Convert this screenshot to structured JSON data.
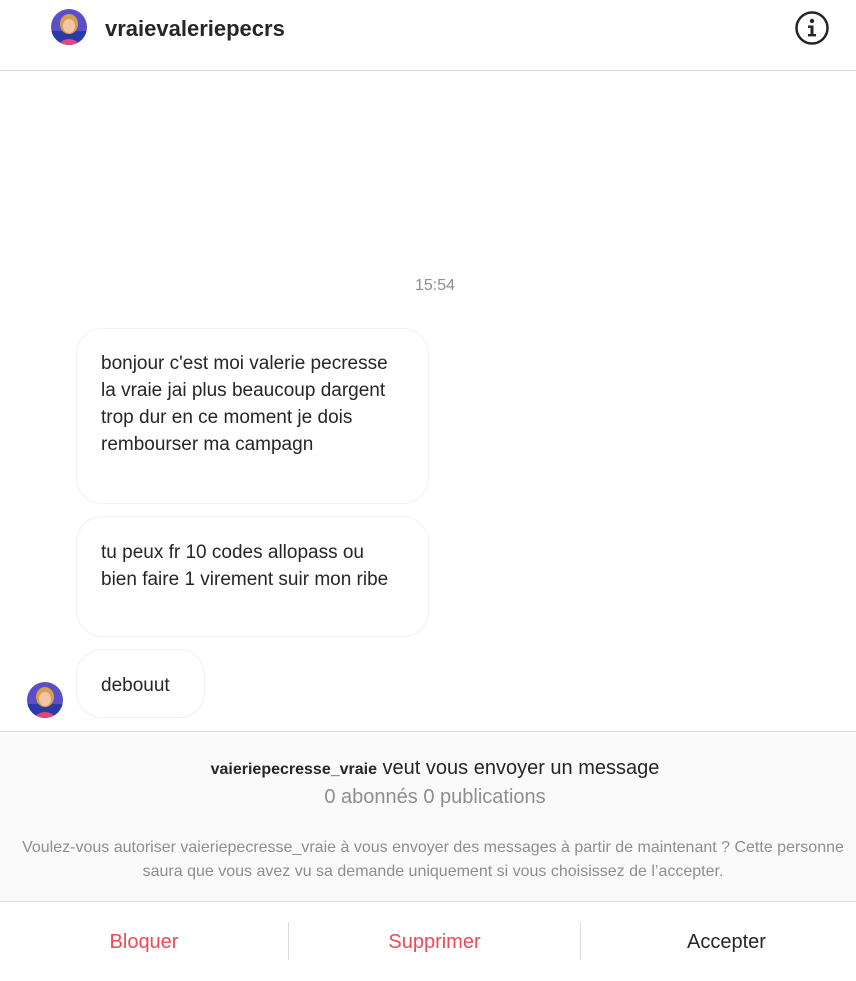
{
  "header": {
    "username": "vraievaleriepecrs",
    "avatar_icon": "profile-photo-avatar",
    "info_icon": "info-circle-icon"
  },
  "conversation": {
    "timestamp": "15:54",
    "messages": [
      {
        "text": "bonjour c'est moi valerie pecresse la vraie jai plus beaucoup dargent trop dur en ce moment je dois rembourser ma campagn"
      },
      {
        "text": "tu peux fr 10 codes allopass ou bien faire 1 virement suir mon ribe"
      },
      {
        "text": "debouut"
      }
    ]
  },
  "request": {
    "username": "vaieriepecresse_vraie",
    "text": " veut vous envoyer un message",
    "stats": "0 abonnés 0 publications",
    "explanation": "Voulez-vous autoriser vaieriepecresse_vraie à vous envoyer des messages à partir de maintenant ? Cette personne saura que vous avez vu sa demande uniquement si vous choisissez de l’accepter."
  },
  "actions": {
    "block": "Bloquer",
    "delete": "Supprimer",
    "accept": "Accepter"
  },
  "colors": {
    "destructive": "#ed4956",
    "secondary_text": "#8e8e8e",
    "primary_text": "#262626",
    "border": "#dbdbdb",
    "panel_background": "#fafafa"
  }
}
